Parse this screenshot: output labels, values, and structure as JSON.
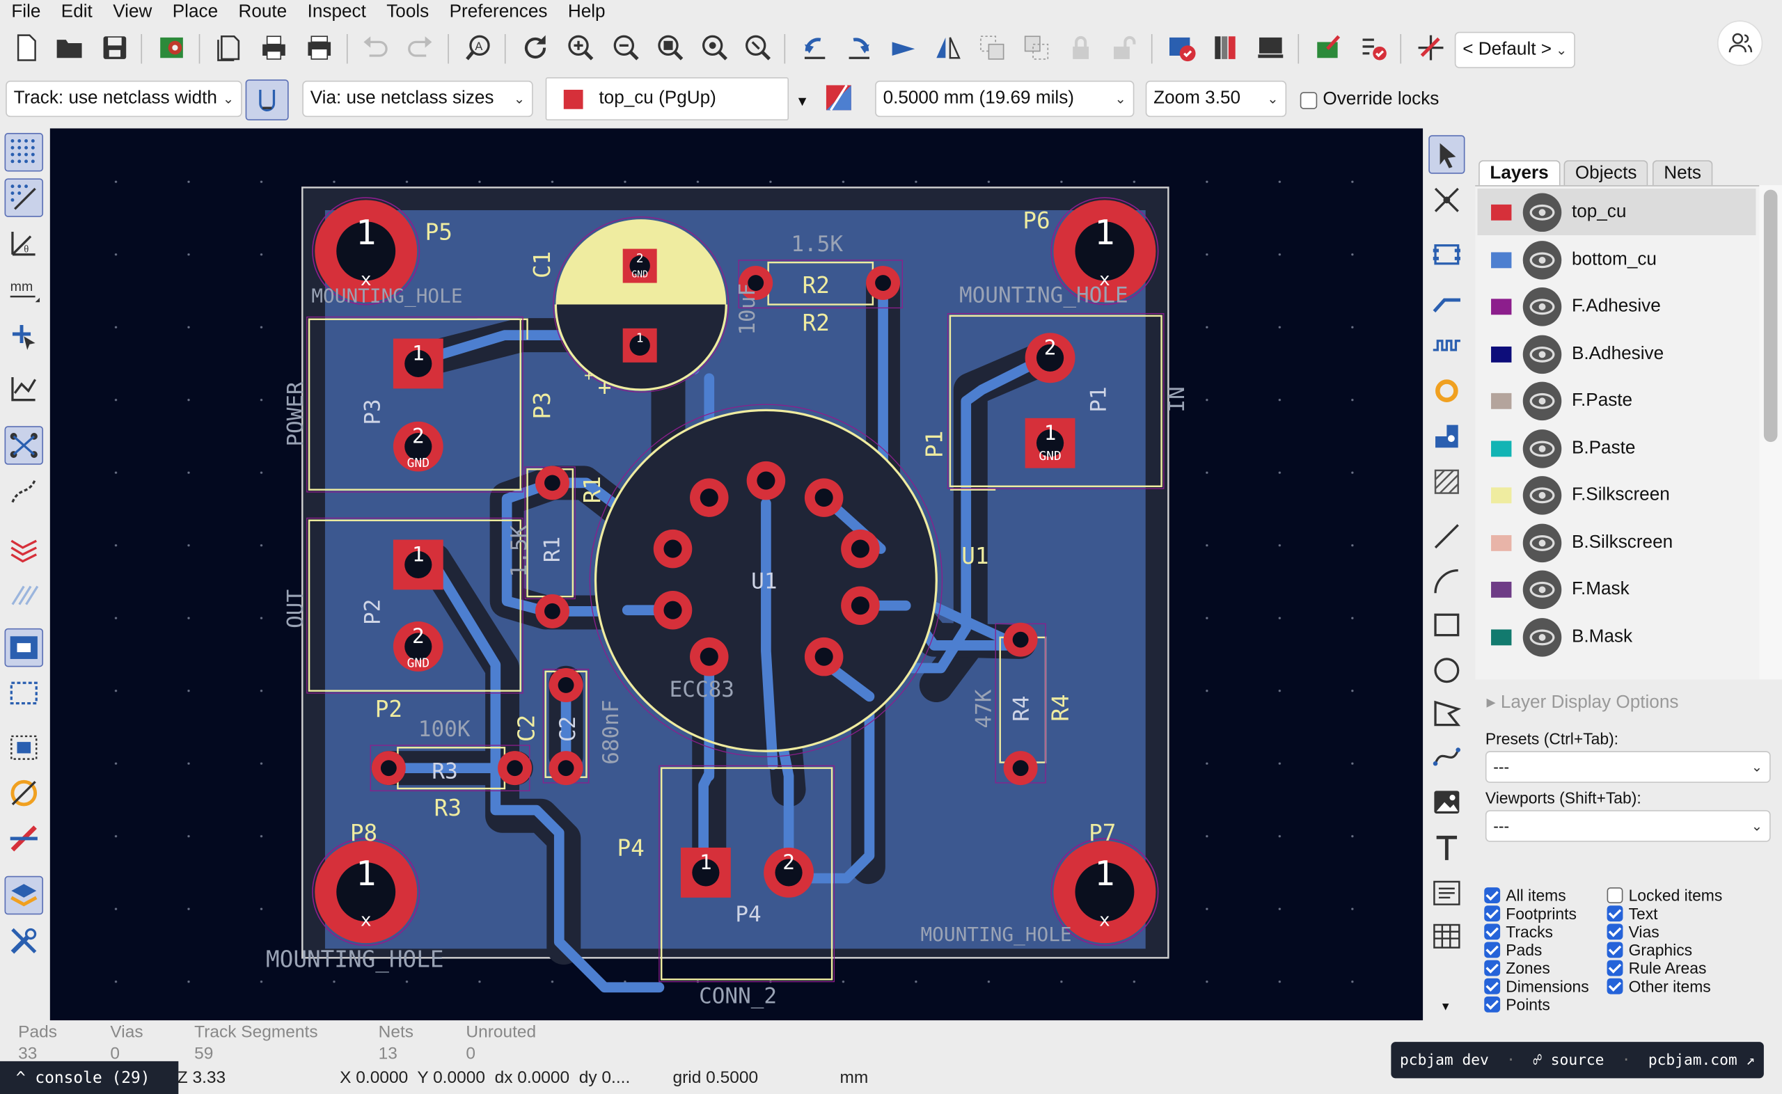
{
  "menu": [
    "File",
    "Edit",
    "View",
    "Place",
    "Route",
    "Inspect",
    "Tools",
    "Preferences",
    "Help"
  ],
  "toolbar": {
    "preset_select": "< Default >",
    "track_select": "Track: use netclass width",
    "via_select": "Via: use netclass sizes",
    "layer_select": "top_cu (PgUp)",
    "grid_select": "0.5000 mm (19.69 mils)",
    "zoom_select": "Zoom 3.50",
    "override_locks": "Override locks"
  },
  "panel": {
    "tabs": [
      "Layers",
      "Objects",
      "Nets"
    ],
    "layers": [
      {
        "name": "top_cu",
        "color": "#d6303a"
      },
      {
        "name": "bottom_cu",
        "color": "#4d7fd0"
      },
      {
        "name": "F.Adhesive",
        "color": "#8c1e8c"
      },
      {
        "name": "B.Adhesive",
        "color": "#0d0d7a"
      },
      {
        "name": "F.Paste",
        "color": "#b4a49c"
      },
      {
        "name": "B.Paste",
        "color": "#12b4b4"
      },
      {
        "name": "F.Silkscreen",
        "color": "#efeca0"
      },
      {
        "name": "B.Silkscreen",
        "color": "#e8b4a8"
      },
      {
        "name": "F.Mask",
        "color": "#6e3c86"
      },
      {
        "name": "B.Mask",
        "color": "#127a6e"
      }
    ],
    "layer_display_options": "Layer Display Options",
    "presets_label": "Presets (Ctrl+Tab):",
    "presets_value": "---",
    "viewports_label": "Viewports (Shift+Tab):",
    "viewports_value": "---",
    "filters_left": [
      {
        "label": "All items",
        "checked": true
      },
      {
        "label": "Footprints",
        "checked": true
      },
      {
        "label": "Tracks",
        "checked": true
      },
      {
        "label": "Pads",
        "checked": true
      },
      {
        "label": "Zones",
        "checked": true
      },
      {
        "label": "Dimensions",
        "checked": true
      },
      {
        "label": "Points",
        "checked": true
      }
    ],
    "filters_right": [
      {
        "label": "Locked items",
        "checked": false
      },
      {
        "label": "Text",
        "checked": true
      },
      {
        "label": "Vias",
        "checked": true
      },
      {
        "label": "Graphics",
        "checked": true
      },
      {
        "label": "Rule Areas",
        "checked": true
      },
      {
        "label": "Other items",
        "checked": true
      }
    ]
  },
  "status": {
    "pads_label": "Pads",
    "pads_value": "33",
    "vias_label": "Vias",
    "vias_value": "0",
    "tracks_label": "Track Segments",
    "tracks_value": "59",
    "nets_label": "Nets",
    "nets_value": "13",
    "unrouted_label": "Unrouted",
    "unrouted_value": "0",
    "zoom": "Z 3.33",
    "coords": "X 0.0000  Y 0.0000  dx 0.0000  dy 0....",
    "grid": "grid 0.5000",
    "units": "mm"
  },
  "console": "^ console (29)",
  "brand": {
    "dev": "pcbjam dev",
    "source": "source",
    "site": "pcbjam.com"
  },
  "pcb": {
    "refs": [
      "P5",
      "P6",
      "P8",
      "P7",
      "C1",
      "R2",
      "R2",
      "P3",
      "P3",
      "P1",
      "P1",
      "R1",
      "R1",
      "U1",
      "U1",
      "P2",
      "P2",
      "R3",
      "R3",
      "C2",
      "C2",
      "R4",
      "R4",
      "P4",
      "P4"
    ],
    "values": {
      "mh": "MOUNTING_HOLE",
      "r2": "1.5K",
      "c1": "10uF",
      "r1": "1.5K",
      "u1": "ECC83",
      "r3": "100K",
      "c2": "680nF",
      "r4": "47K",
      "p4": "CONN_2"
    },
    "edge_text": {
      "power": "POWER",
      "out": "OUT",
      "in": "IN"
    },
    "pin_labels": {
      "one": "1",
      "two": "2",
      "gnd": "GND",
      "x": "x"
    }
  }
}
